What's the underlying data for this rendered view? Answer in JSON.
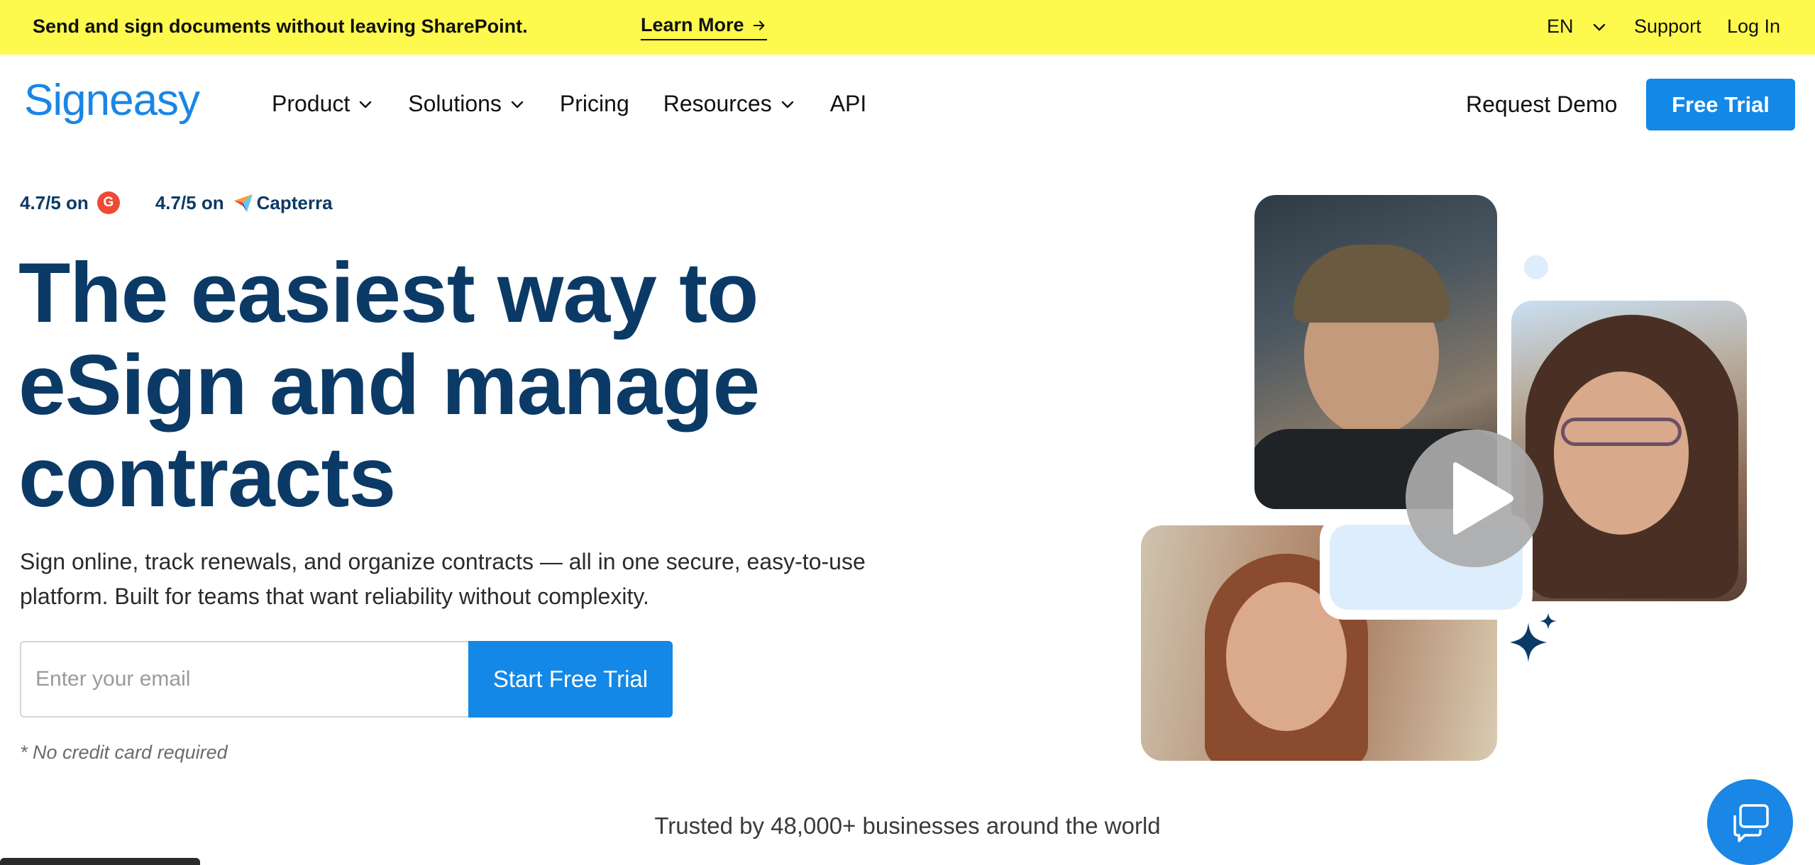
{
  "announcement": {
    "message": "Send and sign documents without leaving SharePoint.",
    "learn_more": "Learn More",
    "language": "EN",
    "support": "Support",
    "login": "Log In"
  },
  "brand": {
    "logo": "Signeasy",
    "accent": "#1488e6",
    "banner_color": "#fdf94d",
    "heading_color": "#0b3a66"
  },
  "nav": {
    "items": [
      {
        "label": "Product",
        "dropdown": true
      },
      {
        "label": "Solutions",
        "dropdown": true
      },
      {
        "label": "Pricing",
        "dropdown": false
      },
      {
        "label": "Resources",
        "dropdown": true
      },
      {
        "label": "API",
        "dropdown": false
      }
    ],
    "request_demo": "Request Demo",
    "free_trial": "Free Trial"
  },
  "ratings": [
    {
      "text": "4.7/5 on",
      "site": "G2",
      "icon": "g2-logo-icon"
    },
    {
      "text": "4.7/5 on",
      "site": "Capterra",
      "icon": "capterra-logo-icon"
    }
  ],
  "hero": {
    "headline_lines": [
      "The easiest way to",
      "eSign and manage",
      "contracts"
    ],
    "subtext_lines": [
      "Sign online, track renewals, and organize contracts — all in one secure, easy-to-use",
      "platform. Built for teams that want reliability without complexity."
    ],
    "email_placeholder": "Enter your email",
    "cta": "Start Free Trial",
    "note": "* No credit card required"
  },
  "trusted": "Trusted by 48,000+ businesses around the world",
  "media": {
    "play_icon": "play-icon",
    "chat_icon": "chat-bubbles-icon"
  }
}
